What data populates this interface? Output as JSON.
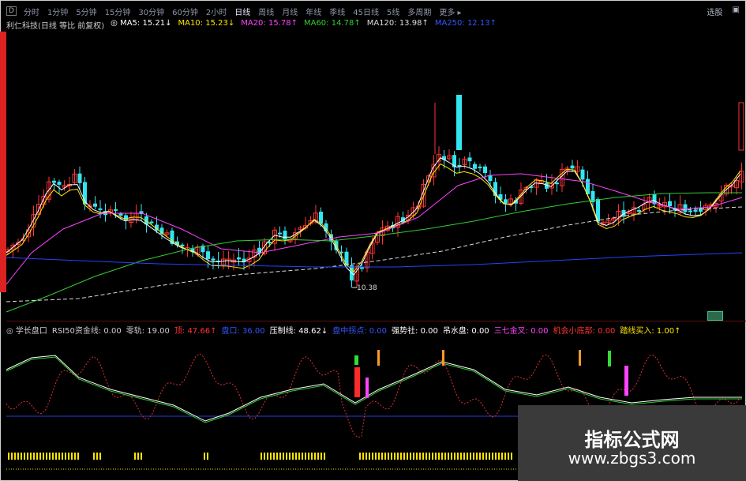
{
  "colors": {
    "up": "#ff3333",
    "down": "#33e5f0",
    "ma5": "#ffffff",
    "ma10": "#ffe600",
    "ma20": "#ff44ff",
    "ma60": "#33cc33",
    "ma120": "#dddddd",
    "ma250": "#2244ff"
  },
  "toolbar": {
    "box": "D",
    "items": [
      "分时",
      "1分钟",
      "5分钟",
      "15分钟",
      "30分钟",
      "60分钟",
      "2小时",
      "日线",
      "周线",
      "月线",
      "年线",
      "季线",
      "45日线",
      "5线",
      "多周期",
      "更多 ▸"
    ],
    "active_index": 7,
    "right": [
      "选股",
      "▣"
    ]
  },
  "main_legend": [
    {
      "text": "利仁科技(日线 等比 前复权)",
      "color": "#cccccc"
    },
    {
      "text": "◎ MA5: 15.21↓",
      "color": "#ffffff"
    },
    {
      "text": "MA10: 15.23↓",
      "color": "#ffe600"
    },
    {
      "text": "MA20: 15.78↑",
      "color": "#ff44ff"
    },
    {
      "text": "MA60: 14.78↑",
      "color": "#33cc33"
    },
    {
      "text": "MA120: 13.98↑",
      "color": "#dddddd"
    },
    {
      "text": "MA250: 12.13↑",
      "color": "#3355ff"
    }
  ],
  "low_label": "10.38",
  "indicator_legend": [
    {
      "text": "◎ 学长盘口",
      "color": "#cccccc"
    },
    {
      "text": "RSI50资金线: 0.00",
      "color": "#cccccc"
    },
    {
      "text": "零轨: 19.00",
      "color": "#cccccc"
    },
    {
      "text": "顶: 47.66↑",
      "color": "#ff3333"
    },
    {
      "text": "盘口: 36.00",
      "color": "#3355ff"
    },
    {
      "text": "压制线: 48.62↓",
      "color": "#ffffff"
    },
    {
      "text": "盘中拐点: 0.00",
      "color": "#3355ff"
    },
    {
      "text": "强势社: 0.00",
      "color": "#ffffff"
    },
    {
      "text": "吊水盘: 0.00",
      "color": "#ffffff"
    },
    {
      "text": "三七金叉: 0.00",
      "color": "#ff44ff"
    },
    {
      "text": "机会小底部: 0.00",
      "color": "#ff3333"
    },
    {
      "text": "踏线买入: 1.00↑",
      "color": "#ffe600"
    }
  ],
  "watermark": {
    "title": "指标公式网",
    "url": "www.zbgs3.com"
  }
}
